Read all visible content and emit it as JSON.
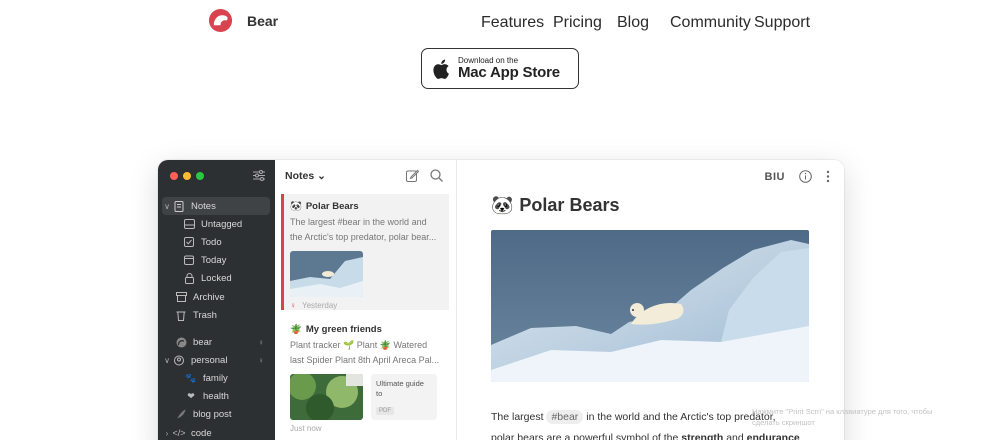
{
  "brand": {
    "name": "Bear",
    "accent": "#d7444f"
  },
  "nav": [
    "Features",
    "Pricing",
    "Blog",
    "Community",
    "Support"
  ],
  "appstore": {
    "small": "Download on the",
    "big": "Mac App Store"
  },
  "sidebar": {
    "items": [
      {
        "label": "Notes",
        "icon": "note-icon",
        "chevron": "∨"
      },
      {
        "label": "Untagged",
        "icon": "untagged-icon"
      },
      {
        "label": "Todo",
        "icon": "checkbox-icon"
      },
      {
        "label": "Today",
        "icon": "calendar-icon"
      },
      {
        "label": "Locked",
        "icon": "lock-icon"
      },
      {
        "label": "Archive",
        "icon": "archive-icon"
      },
      {
        "label": "Trash",
        "icon": "trash-icon"
      },
      {
        "label": "bear",
        "icon": "bear-tag-icon"
      },
      {
        "label": "personal",
        "icon": "tag-icon",
        "chevron": "∨"
      },
      {
        "label": "family",
        "icon": "paw-icon"
      },
      {
        "label": "health",
        "icon": "heart-icon"
      },
      {
        "label": "blog post",
        "icon": "feather-icon"
      },
      {
        "label": "code",
        "icon": "code-icon",
        "chevron": "›"
      }
    ]
  },
  "notelist": {
    "title": "Notes ⌄",
    "notes": [
      {
        "emoji": "🐼",
        "title": "Polar Bears",
        "body1": "The largest #bear in the world and",
        "body2": "the Arctic's top predator, polar bear...",
        "date": "Yesterday"
      },
      {
        "emoji": "🪴",
        "title": "My green friends",
        "body1": "Plant tracker 🌱 Plant 🪴 Watered",
        "body2": "last Spider Plant 8th April Areca Pal...",
        "attachment": "Ultimate guide to",
        "attachment_type": "PDF",
        "date": "Just now"
      }
    ]
  },
  "editor": {
    "tools": "BIU",
    "title_emoji": "🐼",
    "title": "Polar Bears",
    "text_pre": "The largest",
    "tag": "#bear",
    "text_post": "in the world and the Arctic's top predator,",
    "text_line2_pre": "polar bears are a powerful symbol of the",
    "bold1": "strength",
    "and": "and",
    "bold2": "endurance"
  },
  "hint": {
    "line1": "Нажмите \"Print Scrn\" на клавиатуре для того, чтобы",
    "line2": "сделать скриншот"
  }
}
